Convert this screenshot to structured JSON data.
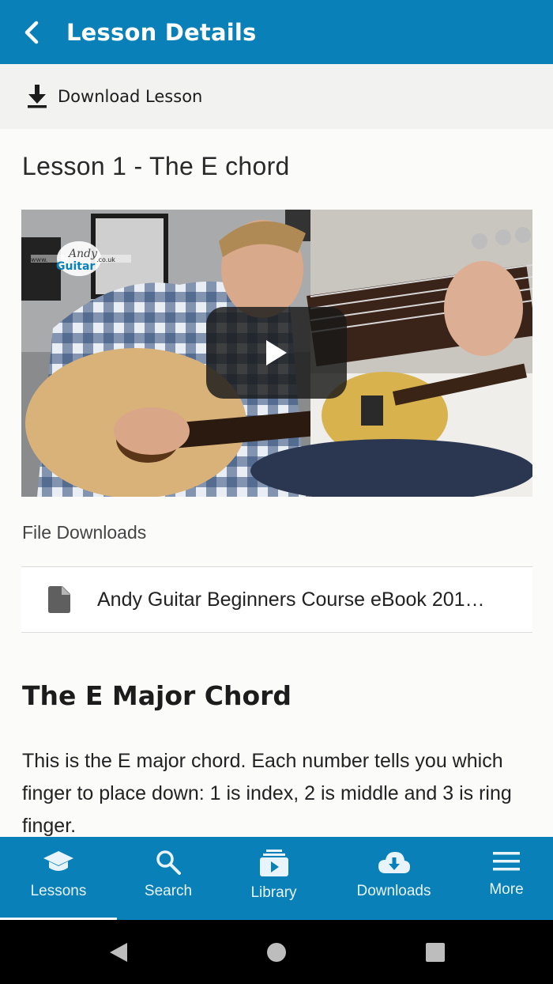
{
  "app_bar": {
    "title": "Lesson Details",
    "back_icon": "chevron-left-icon"
  },
  "download_bar": {
    "label": "Download Lesson",
    "icon": "download-icon"
  },
  "lesson": {
    "title": "Lesson 1 - The E chord",
    "video": {
      "play_icon": "play-icon",
      "watermark_top": "Andy",
      "watermark_brand": "Guitar",
      "watermark_prefix": "www.",
      "watermark_suffix": ".co.uk"
    }
  },
  "file_downloads": {
    "heading": "File Downloads",
    "files": [
      {
        "name": "Andy Guitar Beginners Course eBook 201…",
        "icon": "file-icon"
      }
    ]
  },
  "content": {
    "heading": "The E Major Chord",
    "body": "This is the E major chord. Each number tells you which finger to place down: 1 is index, 2 is middle and 3 is ring finger."
  },
  "bottom_nav": {
    "items": [
      {
        "label": "Lessons",
        "icon": "graduation-cap-icon",
        "active": true
      },
      {
        "label": "Search",
        "icon": "search-icon",
        "active": false
      },
      {
        "label": "Library",
        "icon": "library-icon",
        "active": false
      },
      {
        "label": "Downloads",
        "icon": "cloud-download-icon",
        "active": false
      },
      {
        "label": "More",
        "icon": "menu-icon",
        "active": false
      }
    ]
  },
  "colors": {
    "primary": "#0a80b8",
    "background": "#fbfbf9",
    "download_bar": "#f2f2f1"
  }
}
